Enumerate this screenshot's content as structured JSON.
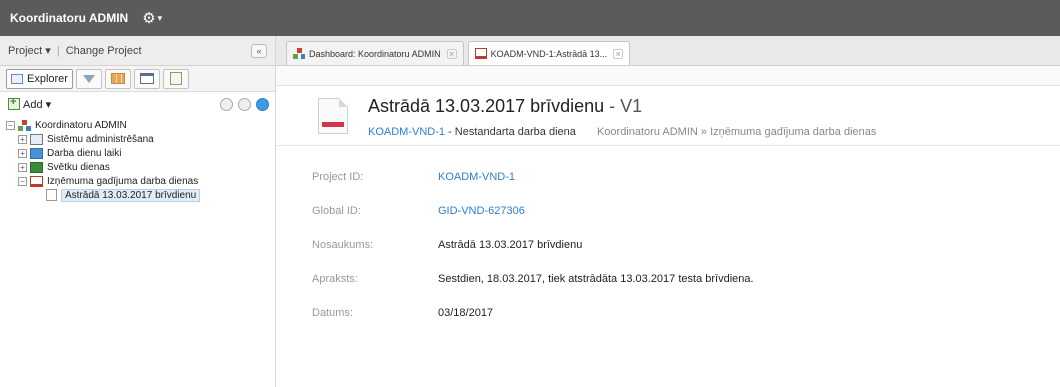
{
  "app": {
    "title": "Koordinatoru ADMIN"
  },
  "left_panel": {
    "project_menu": "Project ▾",
    "change_project": "Change Project",
    "collapse": "«",
    "tabs": {
      "explorer": "Explorer"
    },
    "add_label": "Add ▾",
    "tree": [
      {
        "label": "Koordinatoru ADMIN",
        "icon": "org-icon",
        "expander": "−"
      },
      {
        "label": "Sistēmu administrēšana",
        "icon": "system-icon",
        "expander": "+"
      },
      {
        "label": "Darba dienu laiki",
        "icon": "folder-blue-icon",
        "expander": "+"
      },
      {
        "label": "Svētku dienas",
        "icon": "folder-green-icon",
        "expander": "+"
      },
      {
        "label": "Izņēmuma gadījuma darba dienas",
        "icon": "folder-red-icon",
        "expander": "−"
      },
      {
        "label": "Astrādā 13.03.2017 brīvdienu",
        "icon": "document-icon"
      }
    ]
  },
  "tabs": [
    {
      "label": "Dashboard: Koordinatoru ADMIN",
      "close": "×"
    },
    {
      "label": "KOADM-VND-1:Astrādā 13...",
      "close": "×"
    }
  ],
  "workitem": {
    "title": "Astrādā 13.03.2017 brīvdienu",
    "version": " - V1",
    "id_link": "KOADM-VND-1",
    "type_sep": " - ",
    "type": "Nestandarta darba diena",
    "breadcrumb": "Koordinatoru ADMIN » Izņēmuma gadījuma darba dienas"
  },
  "fields": [
    {
      "label": "Project ID:",
      "value": "KOADM-VND-1",
      "link": true
    },
    {
      "label": "Global ID:",
      "value": "GID-VND-627306",
      "link": true
    },
    {
      "label": "Nosaukums:",
      "value": "Astrādā 13.03.2017 brīvdienu",
      "link": false
    },
    {
      "label": "Apraksts:",
      "value": "Sestdien, 18.03.2017, tiek atstrādāta 13.03.2017 testa brīvdiena.",
      "link": false
    },
    {
      "label": "Datums:",
      "value": "03/18/2017",
      "link": false
    }
  ],
  "colors": {
    "topbar": "#5b5b5b",
    "link": "#2d7fd2",
    "accent_red": "#d0384a"
  }
}
